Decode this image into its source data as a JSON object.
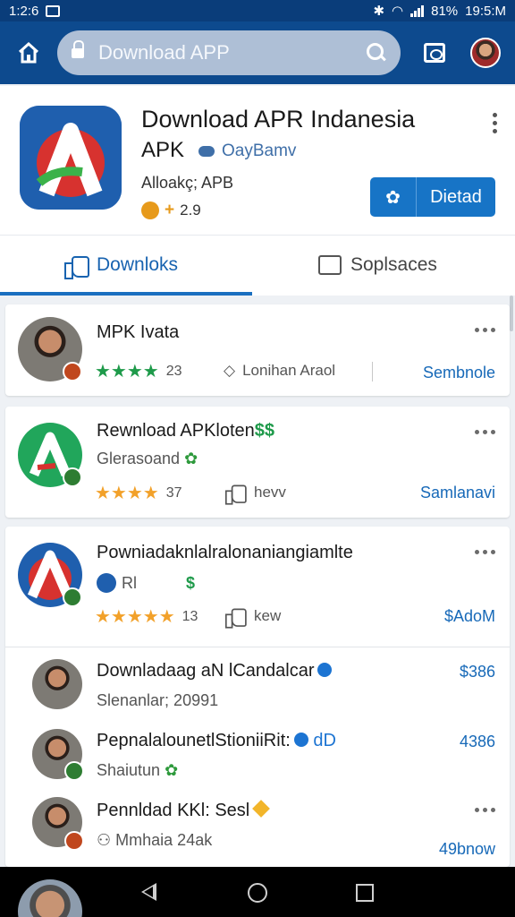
{
  "status_bar": {
    "time": "1:2:6",
    "battery": "81%",
    "clock": "19:5:M"
  },
  "search": {
    "text": "Download APP"
  },
  "app": {
    "title_line1": "Download APR Indanesia",
    "title_line2": "APK",
    "developer": "OayBamv",
    "subtitle": "Alloakç; APB",
    "rating_value": "2.9",
    "install_label": "Dietad"
  },
  "tabs": {
    "active": "Downloks",
    "other": "Soplsaces"
  },
  "rows": [
    {
      "title": "MPK Ivata",
      "rating": "23",
      "meta": "Lonihan Araol",
      "price": "Sembnole",
      "stars": 4,
      "star_color": "#1e9a4a"
    },
    {
      "title": "Rewnload APKloten",
      "extra": "$$",
      "subtitle": "Glerasoand",
      "rating": "37",
      "meta": "hevv",
      "price": "Samlanavi",
      "stars": 4,
      "star_color": "#f2a12a"
    },
    {
      "title": "Powniadaknlalralonaniangiamlte",
      "subtitle": "Rl",
      "extra": "$",
      "rating": "13",
      "meta": "kew",
      "price": "$AdoM",
      "stars": 5,
      "star_color": "#f2a12a"
    }
  ],
  "sub_rows": [
    {
      "title": "Downladaag aN lCandalcar",
      "subtitle": "Slenanlar; 20991",
      "price": "$386"
    },
    {
      "title": "PepnalalounetlStioniiRit:",
      "tag": "dD",
      "subtitle": "Shaiutun",
      "price": "4386"
    },
    {
      "title": "Pennldad KKl: Sesl",
      "subtitle": "Mmhaia 24ak",
      "price": "49bnow"
    }
  ],
  "colors": {
    "brand": "#0d4a8e",
    "accent": "#1774c6",
    "price": "#1769b8"
  }
}
